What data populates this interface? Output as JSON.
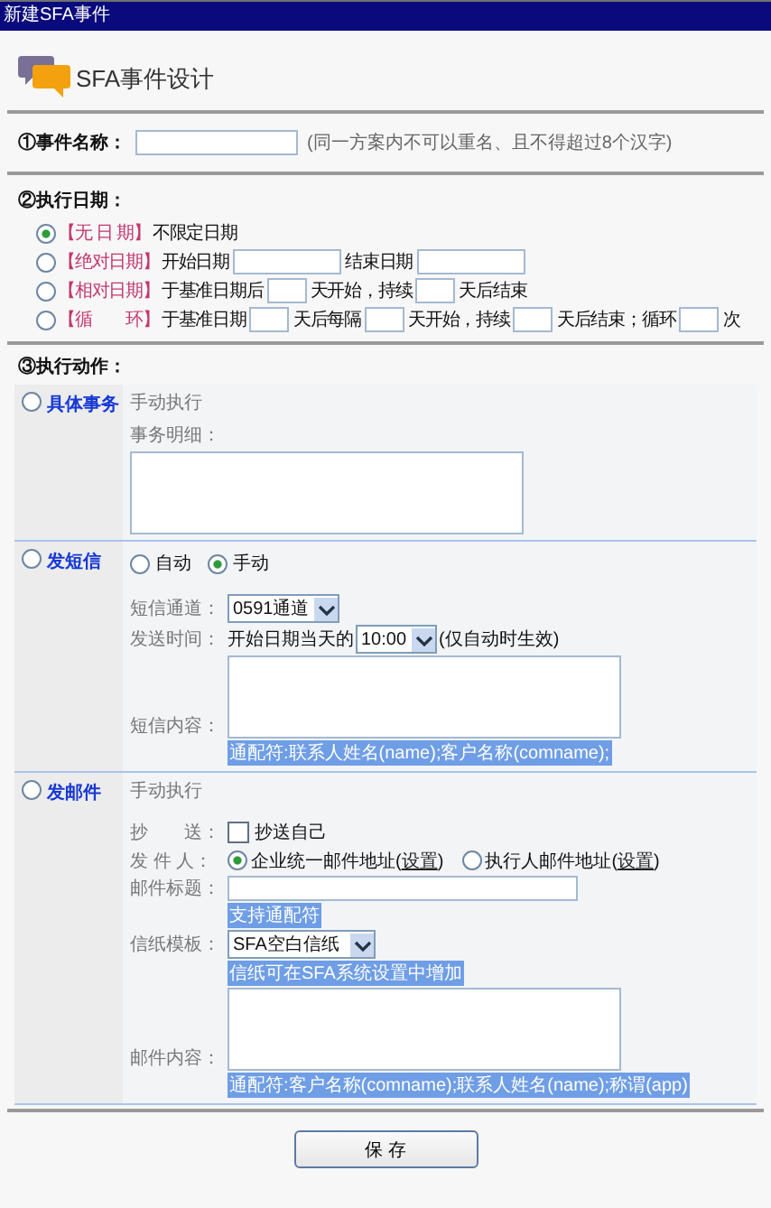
{
  "window": {
    "title": "新建SFA事件"
  },
  "header": {
    "title": "SFA事件设计"
  },
  "event_name": {
    "label": "①事件名称：",
    "hint": "(同一方案内不可以重名、且不得超过8个汉字)"
  },
  "schedule": {
    "label": "②执行日期：",
    "options": [
      {
        "tag": "【无 日 期】",
        "selected": true,
        "parts": [
          {
            "kind": "text",
            "text": "不限定日期"
          }
        ]
      },
      {
        "tag": "【绝对日期】",
        "selected": false,
        "parts": [
          {
            "kind": "text",
            "text": "开始日期"
          },
          {
            "kind": "wide_field"
          },
          {
            "kind": "text",
            "text": "结束日期"
          },
          {
            "kind": "wide_field"
          }
        ]
      },
      {
        "tag": "【相对日期】",
        "selected": false,
        "parts": [
          {
            "kind": "text",
            "text": "于基准日期后"
          },
          {
            "kind": "field"
          },
          {
            "kind": "text",
            "text": "天开始，持续"
          },
          {
            "kind": "field"
          },
          {
            "kind": "text",
            "text": "天后结束"
          }
        ]
      },
      {
        "tag": "【循　　环】",
        "selected": false,
        "parts": [
          {
            "kind": "text",
            "text": "于基准日期"
          },
          {
            "kind": "field"
          },
          {
            "kind": "text",
            "text": "天后每隔"
          },
          {
            "kind": "field"
          },
          {
            "kind": "text",
            "text": "天开始，持续"
          },
          {
            "kind": "field"
          },
          {
            "kind": "text",
            "text": "天后结束；循环"
          },
          {
            "kind": "field"
          },
          {
            "kind": "text",
            "text": "次"
          }
        ]
      }
    ]
  },
  "actions": {
    "label": "③执行动作：",
    "items": [
      {
        "kind": "task",
        "title": "具体事务",
        "selected": false,
        "mode": "手动执行",
        "detail_label": "事务明细："
      },
      {
        "kind": "sms",
        "title": "发短信",
        "selected": false,
        "send_modes": [
          {
            "label": "自动",
            "selected": false
          },
          {
            "label": "手动",
            "selected": true
          }
        ],
        "channel": {
          "label": "短信通道：",
          "value": "0591通道"
        },
        "send_time": {
          "label": "发送时间：",
          "prefix": "开始日期当天的",
          "value": "10:00",
          "note": "(仅自动时生效)"
        },
        "content": {
          "label": "短信内容：",
          "hint": "通配符:联系人姓名(name);客户名称(comname);"
        }
      },
      {
        "kind": "email",
        "title": "发邮件",
        "selected": false,
        "mode": "手动执行",
        "cc": {
          "label": "抄　　送：",
          "option": "抄送自己",
          "checked": false
        },
        "sender": {
          "label": "发 件 人：",
          "options": [
            {
              "before": "企业统一邮件地址(",
              "link": "设置",
              "after": ")",
              "selected": true
            },
            {
              "before": "执行人邮件地址(",
              "link": "设置",
              "after": ")",
              "selected": false
            }
          ]
        },
        "subject": {
          "label": "邮件标题：",
          "hint": "支持通配符"
        },
        "template": {
          "label": "信纸模板：",
          "value": "SFA空白信纸",
          "hint": "信纸可在SFA系统设置中增加"
        },
        "content": {
          "label": "邮件内容：",
          "hint": "通配符:客户名称(comname);联系人姓名(name);称谓(app)"
        }
      }
    ]
  },
  "buttons": [
    {
      "label": "保 存"
    }
  ]
}
